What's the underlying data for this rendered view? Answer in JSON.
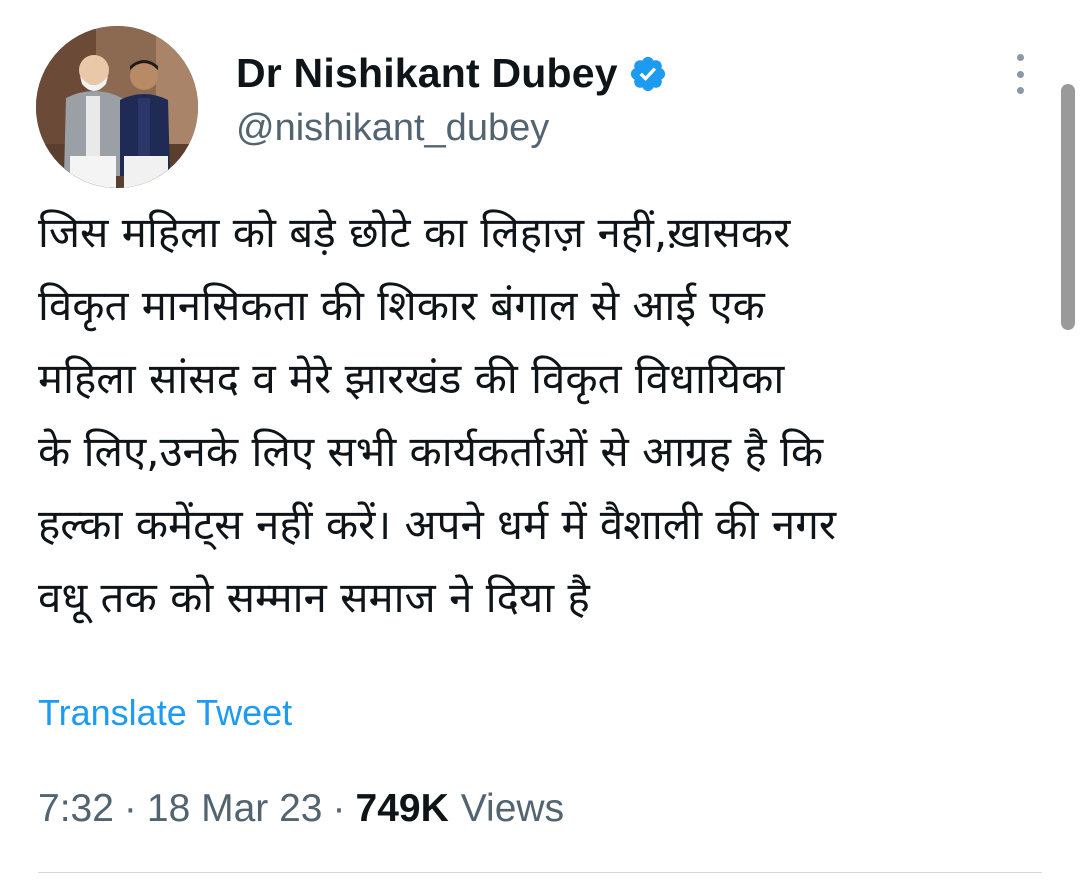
{
  "tweet": {
    "author": {
      "display_name": "Dr Nishikant Dubey",
      "handle": "@nishikant_dubey",
      "verified": true,
      "avatar_icon": "profile-photo"
    },
    "text_lines": [
      "जिस महिला को बड़े छोटे का लिहाज़ नहीं,ख़ासकर",
      "विकृत मानसिकता की शिकार बंगाल से आई एक",
      "महिला सांसद व मेरे झारखंड की विकृत विधायिका",
      "के लिए,उनके लिए सभी कार्यकर्ताओं से आग्रह है कि",
      "हल्का कमेंट्स नहीं करें। अपने धर्म में वैशाली की नगर",
      "वधू तक को सम्मान समाज ने दिया है"
    ],
    "translate_label": "Translate Tweet",
    "time": "7:32",
    "date": "18 Mar 23",
    "separator": "·",
    "views_count": "749K",
    "views_label": "Views"
  },
  "colors": {
    "accent": "#1d9bf0",
    "secondary_text": "#536471",
    "primary_text": "#0f1419"
  },
  "icons": {
    "verified": "verified-badge-icon",
    "more": "more-vertical-icon"
  }
}
